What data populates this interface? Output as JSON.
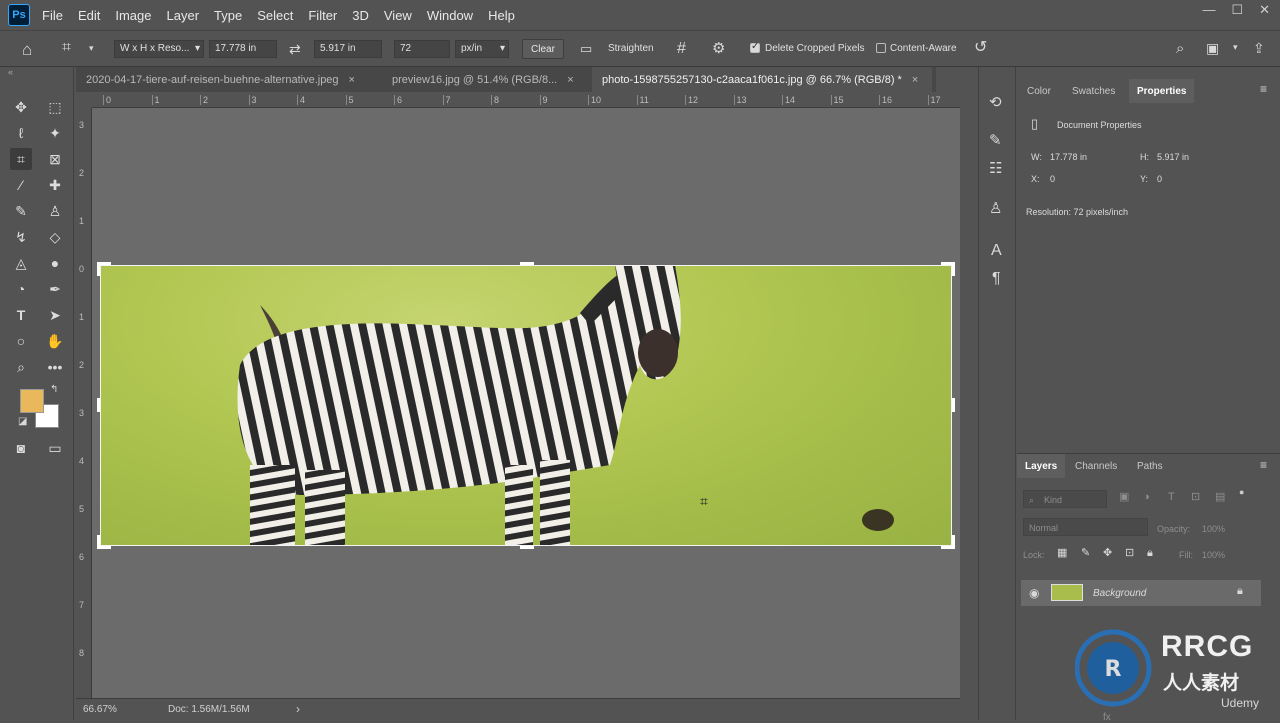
{
  "menu": [
    "File",
    "Edit",
    "Image",
    "Layer",
    "Type",
    "Select",
    "Filter",
    "3D",
    "View",
    "Window",
    "Help"
  ],
  "app_logo": "Ps",
  "options": {
    "ratio": "W x H x Reso...",
    "width": "17.778 in",
    "height": "5.917 in",
    "resolution": "72",
    "units": "px/in",
    "clear": "Clear",
    "straighten": "Straighten",
    "delete_cropped": "Delete Cropped Pixels",
    "content_aware": "Content-Aware"
  },
  "tabs": [
    {
      "label": "2020-04-17-tiere-auf-reisen-buehne-alternative.jpeg",
      "close": "×"
    },
    {
      "label": "preview16.jpg @ 51.4% (RGB/8...",
      "close": "×"
    },
    {
      "label": "photo-1598755257130-c2aaca1f061c.jpg @ 66.7% (RGB/8) *",
      "close": "×"
    }
  ],
  "ruler_h": [
    "0",
    "1",
    "2",
    "3",
    "4",
    "5",
    "6",
    "7",
    "8",
    "9",
    "10",
    "11",
    "12",
    "13",
    "14",
    "15",
    "16",
    "17"
  ],
  "ruler_v": [
    "3",
    "2",
    "1",
    "0",
    "1",
    "2",
    "3",
    "4",
    "5",
    "6",
    "7",
    "8"
  ],
  "status": {
    "zoom": "66.67%",
    "doc": "Doc: 1.56M/1.56M",
    "arrow": "›"
  },
  "panel_tabs": {
    "color": "Color",
    "swatches": "Swatches",
    "properties": "Properties"
  },
  "properties": {
    "header": "Document Properties",
    "w_label": "W:",
    "w_value": "17.778 in",
    "h_label": "H:",
    "h_value": "5.917 in",
    "x_label": "X:",
    "x_value": "0",
    "y_label": "Y:",
    "y_value": "0",
    "resolution": "Resolution: 72 pixels/inch"
  },
  "layers_tabs": {
    "layers": "Layers",
    "channels": "Channels",
    "paths": "Paths"
  },
  "layers": {
    "kind": "Kind",
    "blend": "Normal",
    "opacity_label": "Opacity:",
    "opacity": "100%",
    "lock_label": "Lock:",
    "fill_label": "Fill:",
    "fill": "100%",
    "layer_name": "Background"
  },
  "footer_icons": "fx",
  "watermark": {
    "top": "RRCG",
    "bottom": "人人素材",
    "udemy": "Udemy"
  },
  "colors": {
    "foreground": "#e8b85a",
    "background": "#ffffff"
  }
}
